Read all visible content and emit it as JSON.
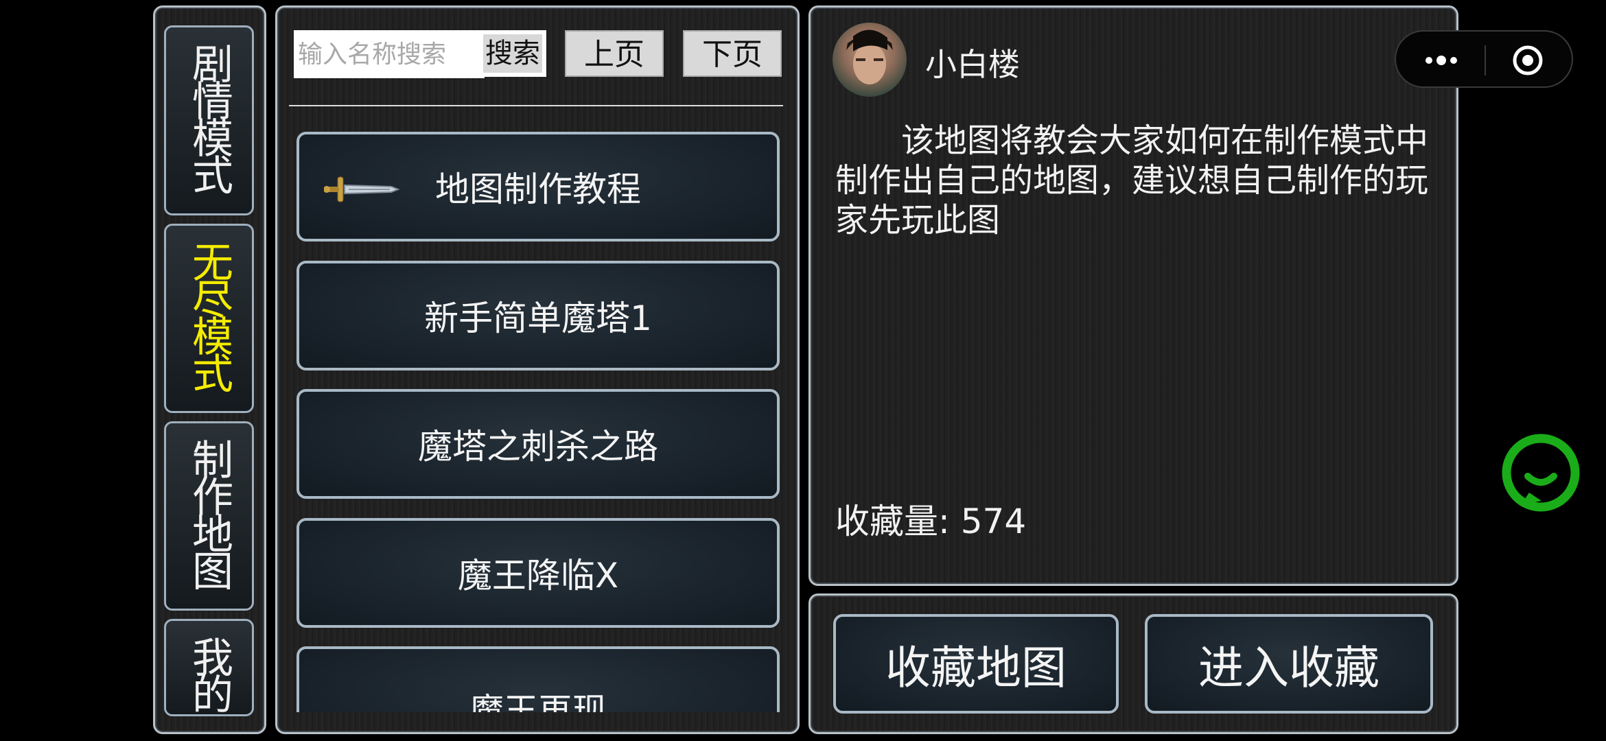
{
  "modes": [
    {
      "label": "剧情模式",
      "active": false
    },
    {
      "label": "无尽模式",
      "active": true
    },
    {
      "label": "制作地图",
      "active": false
    },
    {
      "label": "我的",
      "active": false
    }
  ],
  "search": {
    "placeholder": "输入名称搜索",
    "button": "搜索"
  },
  "pager": {
    "prev": "上页",
    "next": "下页"
  },
  "maps": [
    {
      "name": "地图制作教程",
      "icon": "sword-icon"
    },
    {
      "name": "新手简单魔塔1"
    },
    {
      "name": "魔塔之刺杀之路"
    },
    {
      "name": "魔王降临X"
    },
    {
      "name": "魔王再现"
    }
  ],
  "detail": {
    "author": "小白楼",
    "description": "该地图将教会大家如何在制作模式中制作出自己的地图，建议想自己制作的玩家先玩此图",
    "favorites_label": "收藏量: 574"
  },
  "actions": {
    "favorite": "收藏地图",
    "enter": "进入收藏"
  },
  "colors": {
    "active_tab": "#f5ec00",
    "chat_icon": "#1aad19"
  }
}
